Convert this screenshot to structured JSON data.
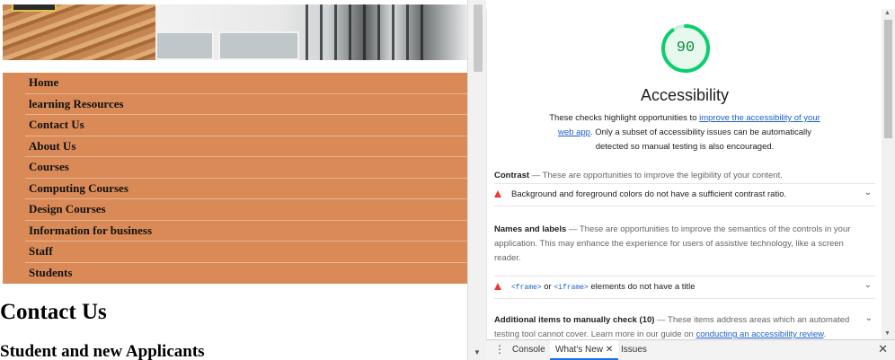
{
  "site": {
    "nav": [
      "Home",
      "learning Resources",
      "Contact Us",
      "About Us",
      "Courses",
      "Computing Courses",
      "Design Courses",
      "Information for business",
      "Staff",
      "Students"
    ],
    "heading": "Contact Us",
    "subheading": "Student and new Applicants",
    "colors": {
      "nav_bg": "#d98a56"
    }
  },
  "lighthouse": {
    "score": "90",
    "score_fraction": 0.9,
    "category_title": "Accessibility",
    "desc_before": "These checks highlight opportunities to ",
    "desc_link": "improve the accessibility of your web app",
    "desc_after": ". Only a subset of accessibility issues can be automatically detected so manual testing is also encouraged.",
    "groups": {
      "contrast_title": "Contrast",
      "contrast_desc": " — These are opportunities to improve the legibility of your content.",
      "names_title": "Names and labels",
      "names_desc": " — These are opportunities to improve the semantics of the controls in your application. This may enhance the experience for users of assistive technology, like a screen reader."
    },
    "audits": {
      "contrast": "Background and foreground colors do not have a sufficient contrast ratio.",
      "frame_code1": "<frame>",
      "frame_or": " or ",
      "frame_code2": "<iframe>",
      "frame_rest": " elements do not have a title"
    },
    "manual": {
      "title": "Additional items to manually check",
      "count": " (10)",
      "desc": " — These items address areas which an automated testing tool cannot cover. Learn more in our guide on ",
      "link": "conducting an accessibility review",
      "end": "."
    },
    "colors": {
      "pass": "#0cce6b",
      "fail": "#eb3b2f",
      "link": "#1a5fc7"
    }
  },
  "drawer": {
    "tabs": [
      "Console",
      "What's New",
      "Issues"
    ],
    "active_tab": "What's New"
  }
}
